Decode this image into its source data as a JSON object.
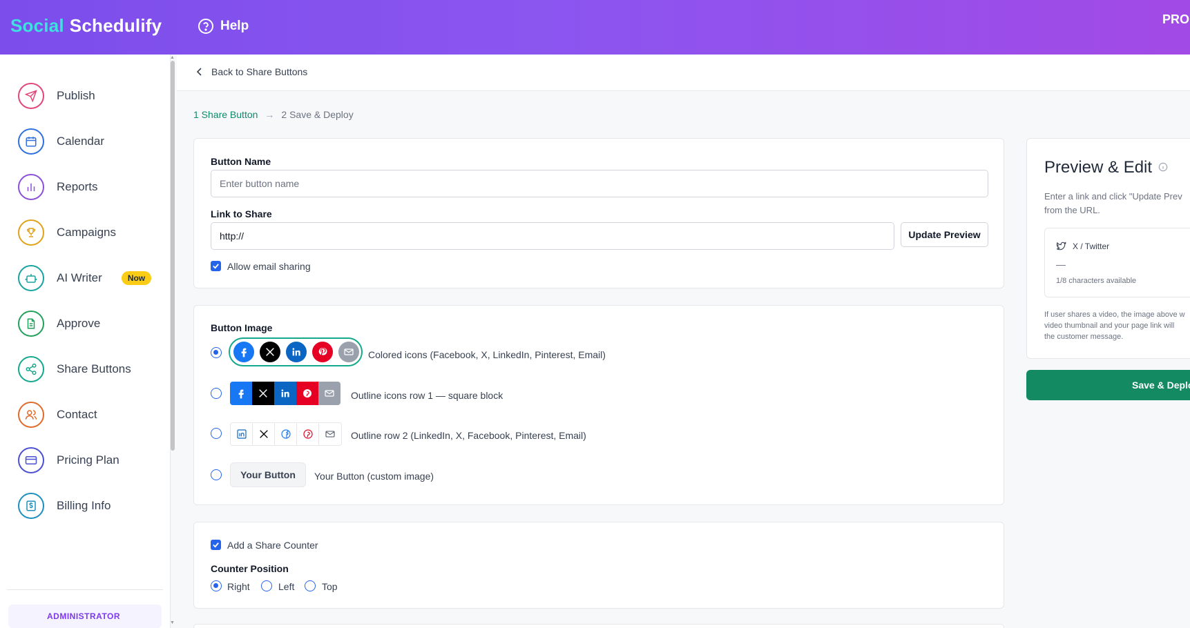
{
  "header": {
    "logo_part1": "Social",
    "logo_part2": "Schedulify",
    "help_label": "Help",
    "plan_label": "PRO"
  },
  "sidebar": {
    "items": [
      {
        "label": "Publish",
        "icon": "send-icon",
        "color": "#e0457b"
      },
      {
        "label": "Calendar",
        "icon": "calendar-icon",
        "color": "#2f6fde"
      },
      {
        "label": "Reports",
        "icon": "bar-chart-icon",
        "color": "#8b4fd9"
      },
      {
        "label": "Campaigns",
        "icon": "trophy-icon",
        "color": "#e0a21a"
      },
      {
        "label": "AI Writer",
        "icon": "robot-icon",
        "color": "#17a3a0",
        "badge": "Now"
      },
      {
        "label": "Approve",
        "icon": "document-icon",
        "color": "#22a05a"
      },
      {
        "label": "Share Buttons",
        "icon": "share-icon",
        "color": "#14a88c"
      },
      {
        "label": "Contact",
        "icon": "users-icon",
        "color": "#e06a2a"
      },
      {
        "label": "Pricing Plan",
        "icon": "credit-card-icon",
        "color": "#4b4fd1"
      },
      {
        "label": "Billing Info",
        "icon": "dollar-icon",
        "color": "#1c8fbf"
      }
    ],
    "role_label": "ADMINISTRATOR"
  },
  "subheader": {
    "back_label": "Back to Share Buttons"
  },
  "steps": {
    "step1": "1 Share Button",
    "arrow": "→",
    "step2": "2 Save & Deploy"
  },
  "form": {
    "button_name_label": "Button Name",
    "button_name_placeholder": "Enter button name",
    "link_label": "Link to Share",
    "link_value": "http://",
    "update_preview_label": "Update Preview",
    "allow_email_label": "Allow email sharing",
    "allow_email_checked": true
  },
  "button_image": {
    "label": "Button Image",
    "options": [
      {
        "label": "Colored icons (Facebook, X, LinkedIn, Pinterest, Email)",
        "selected": true
      },
      {
        "label": "Outline icons row 1 — square block",
        "selected": false
      },
      {
        "label": "Outline row 2 (LinkedIn, X, Facebook, Pinterest, Email)",
        "selected": false
      },
      {
        "label": "Your Button (custom image)",
        "selected": false
      }
    ],
    "custom_button_label": "Your Button"
  },
  "counter": {
    "add_counter_label": "Add a Share Counter",
    "add_counter_checked": true,
    "position_label": "Counter Position",
    "positions": [
      "Right",
      "Left",
      "Top"
    ],
    "selected_position": "Right"
  },
  "preview": {
    "title": "Preview & Edit",
    "desc_line1": "Enter a link and click \"Update Prev",
    "desc_line2": "from the URL.",
    "network_label": "X / Twitter",
    "dash": "—",
    "chars_available": "1/8 characters available",
    "note_line1": "If user shares a video, the image above w",
    "note_line2": "video thumbnail and your page link will",
    "note_line3": "the customer message.",
    "save_deploy_label": "Save & Deplo"
  },
  "colors": {
    "facebook": "#1877f2",
    "x": "#000000",
    "linkedin": "#0a66c2",
    "pinterest": "#e60023",
    "email": "#9aa1ad",
    "accent_green": "#138a62",
    "accent_blue": "#2563eb"
  }
}
